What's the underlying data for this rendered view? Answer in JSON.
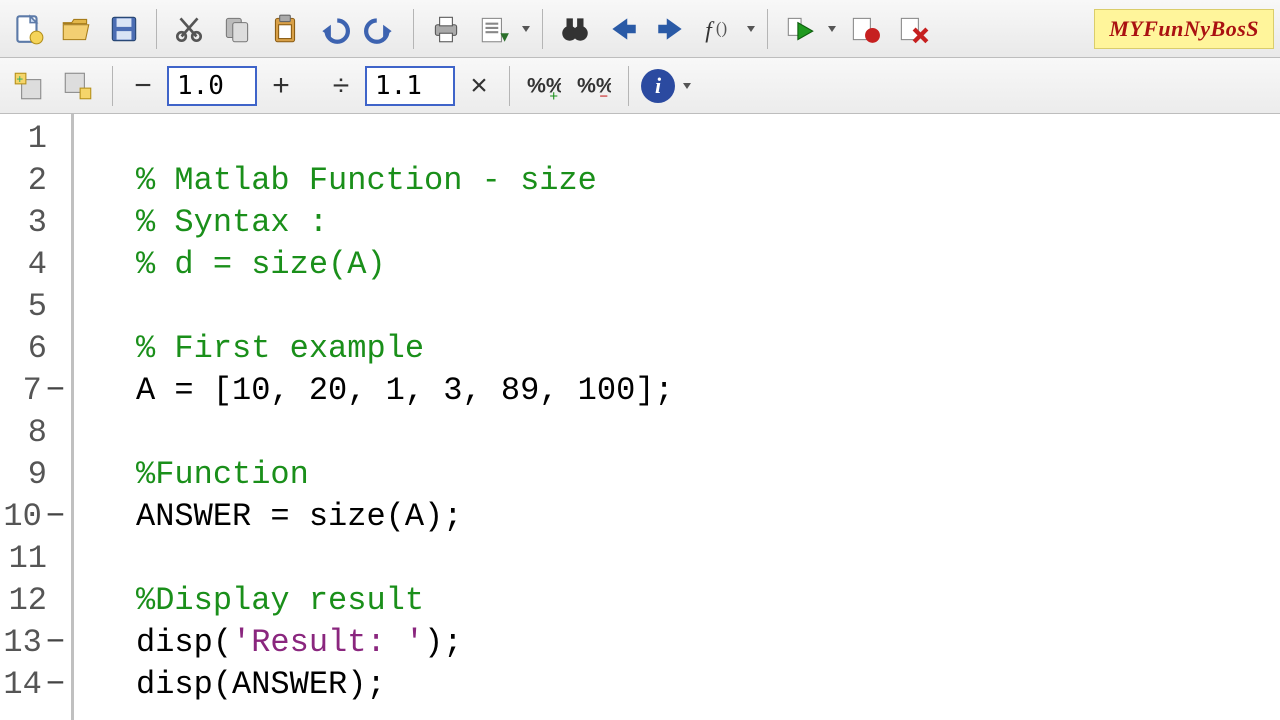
{
  "watermark": "MYFunNyBosS",
  "toolbar2": {
    "step_value": "1.0",
    "factor_value": "1.1"
  },
  "icons": {
    "minus": "−",
    "plus": "+",
    "divide": "÷",
    "times": "×"
  },
  "code_lines": [
    {
      "n": 1,
      "exec": false,
      "segs": []
    },
    {
      "n": 2,
      "exec": false,
      "segs": [
        [
          "comment",
          "% Matlab Function - size"
        ]
      ]
    },
    {
      "n": 3,
      "exec": false,
      "segs": [
        [
          "comment",
          "% Syntax :"
        ]
      ]
    },
    {
      "n": 4,
      "exec": false,
      "segs": [
        [
          "comment",
          "% d = size(A)"
        ]
      ]
    },
    {
      "n": 5,
      "exec": false,
      "segs": []
    },
    {
      "n": 6,
      "exec": false,
      "segs": [
        [
          "comment",
          "% First example"
        ]
      ]
    },
    {
      "n": 7,
      "exec": true,
      "segs": [
        [
          "ident",
          "A = [10, 20, 1, 3, 89, 100];"
        ]
      ]
    },
    {
      "n": 8,
      "exec": false,
      "segs": []
    },
    {
      "n": 9,
      "exec": false,
      "segs": [
        [
          "comment",
          "%Function"
        ]
      ]
    },
    {
      "n": 10,
      "exec": true,
      "segs": [
        [
          "ident",
          "ANSWER = size(A);"
        ]
      ]
    },
    {
      "n": 11,
      "exec": false,
      "segs": []
    },
    {
      "n": 12,
      "exec": false,
      "segs": [
        [
          "comment",
          "%Display result"
        ]
      ]
    },
    {
      "n": 13,
      "exec": true,
      "segs": [
        [
          "ident",
          "disp("
        ],
        [
          "string",
          "'Result: '"
        ],
        [
          "ident",
          ");"
        ]
      ]
    },
    {
      "n": 14,
      "exec": true,
      "segs": [
        [
          "ident",
          "disp(ANSWER);"
        ]
      ]
    }
  ]
}
